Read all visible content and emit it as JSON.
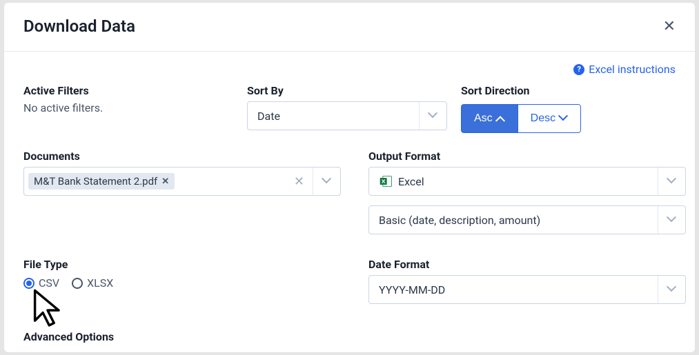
{
  "modal": {
    "title": "Download Data",
    "excel_instructions": "Excel instructions"
  },
  "filters": {
    "label": "Active Filters",
    "value": "No active filters."
  },
  "sort_by": {
    "label": "Sort By",
    "value": "Date"
  },
  "sort_direction": {
    "label": "Sort Direction",
    "asc": "Asc",
    "desc": "Desc"
  },
  "documents": {
    "label": "Documents",
    "selected": "M&T Bank Statement 2.pdf"
  },
  "output_format": {
    "label": "Output Format",
    "value": "Excel",
    "template": "Basic (date, description, amount)"
  },
  "file_type": {
    "label": "File Type",
    "options": [
      "CSV",
      "XLSX"
    ]
  },
  "date_format": {
    "label": "Date Format",
    "value": "YYYY-MM-DD"
  },
  "advanced": {
    "label": "Advanced Options"
  }
}
